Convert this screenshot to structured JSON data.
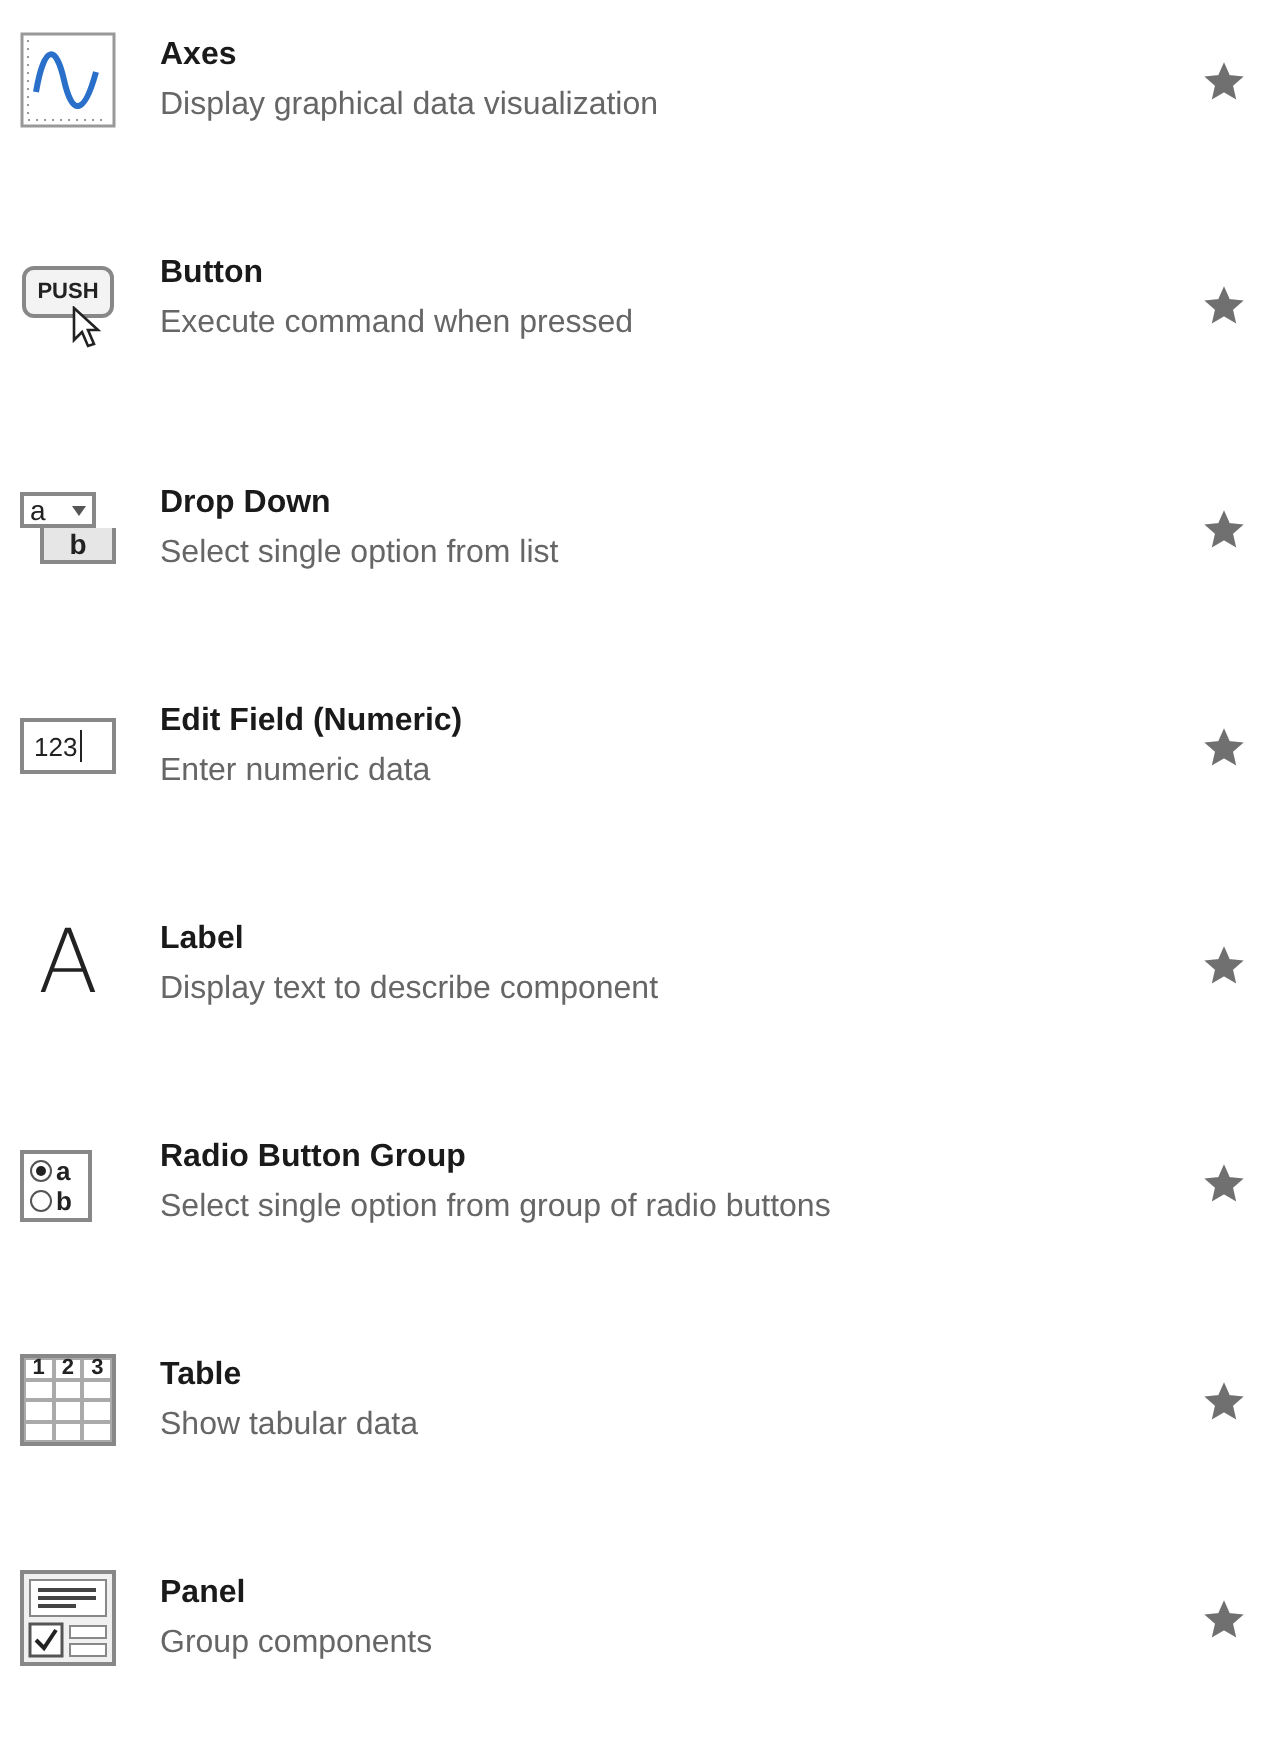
{
  "components": [
    {
      "title": "Axes",
      "description": "Display graphical data visualization",
      "icon": {
        "kind": "axes"
      },
      "starred": true
    },
    {
      "title": "Button",
      "description": "Execute command when pressed",
      "icon": {
        "kind": "push",
        "texts": [
          "PUSH"
        ]
      },
      "starred": true
    },
    {
      "title": "Drop Down",
      "description": "Select single option from list",
      "icon": {
        "kind": "dropdown",
        "texts": [
          "a",
          "b"
        ]
      },
      "starred": true
    },
    {
      "title": "Edit Field (Numeric)",
      "description": "Enter numeric data",
      "icon": {
        "kind": "numeric",
        "texts": [
          "123"
        ]
      },
      "starred": true
    },
    {
      "title": "Label",
      "description": "Display text to describe component",
      "icon": {
        "kind": "label",
        "texts": [
          "A"
        ]
      },
      "starred": true
    },
    {
      "title": "Radio Button Group",
      "description": "Select single option from group of radio buttons",
      "icon": {
        "kind": "radio",
        "texts": [
          "a",
          "b"
        ]
      },
      "starred": true
    },
    {
      "title": "Table",
      "description": "Show tabular data",
      "icon": {
        "kind": "table",
        "texts": [
          "1",
          "2",
          "3"
        ]
      },
      "starred": true
    },
    {
      "title": "Panel",
      "description": "Group components",
      "icon": {
        "kind": "panel"
      },
      "starred": true
    }
  ]
}
